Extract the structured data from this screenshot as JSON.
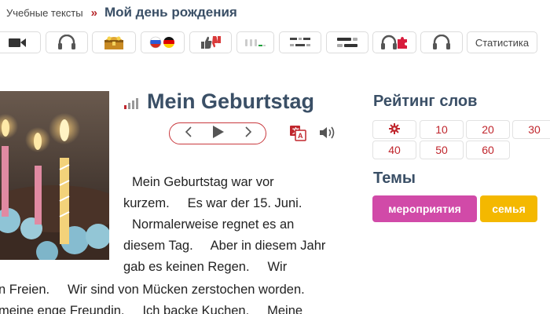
{
  "breadcrumb": {
    "parent": "Учебные тексты",
    "separator": "»",
    "current": "Мой день рождения"
  },
  "toolbar": {
    "icons": [
      "video-camera-icon",
      "headphones-icon",
      "treasure-chest-icon",
      "flags-icon",
      "thumbs-icon",
      "bars-dots-icon",
      "list-lines-icon",
      "blocks-icon",
      "headphones-puzzle-icon",
      "headphones-icon"
    ],
    "statistics_label": "Статистика"
  },
  "article": {
    "title": "Mein Geburtstag",
    "lines": [
      "Mein Geburtstag war vor",
      "kurzem.     Es war der 15. Juni.",
      "Normalerweise regnet es an",
      "diesem Tag.     Aber in diesem Jahr",
      "gab es keinen Regen.     Wir",
      "n Freien.     Wir sind von Mücken zerstochen worden.",
      "meine enge Freundin.     Ich backe Kuchen.     Meine"
    ]
  },
  "rating": {
    "title": "Рейтинг слов",
    "options": [
      "10",
      "20",
      "30",
      "40",
      "50",
      "60"
    ]
  },
  "topics": {
    "title": "Темы",
    "tags": [
      {
        "label": "мероприятия",
        "color": "#d14aa8"
      },
      {
        "label": "семья",
        "color": "#f4b800"
      }
    ]
  },
  "colors": {
    "accent_red": "#c0262d",
    "heading_blue": "#3a4f66"
  }
}
